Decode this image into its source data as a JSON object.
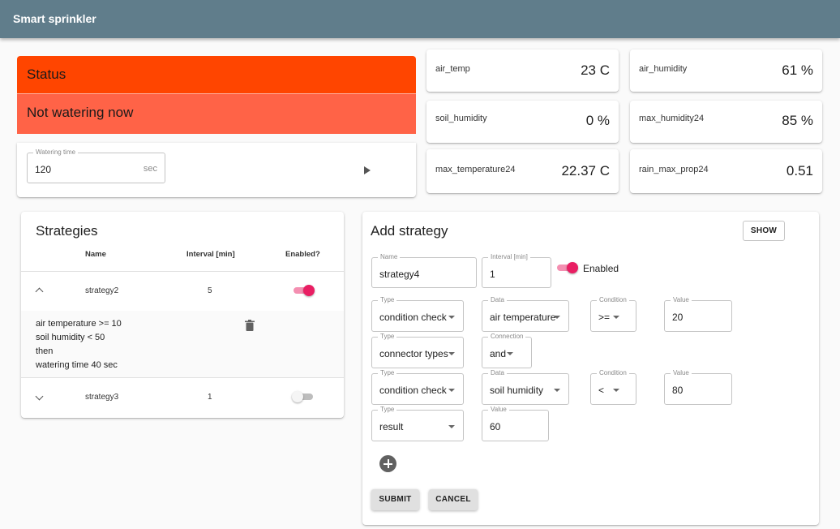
{
  "app": {
    "title": "Smart sprinkler"
  },
  "status": {
    "title": "Status",
    "state": "Not watering now",
    "watering_time": {
      "label": "Watering time",
      "value": "120",
      "unit": "sec"
    },
    "colors": {
      "header": "#ff4500",
      "body": "#ff6347"
    }
  },
  "metrics": [
    {
      "label": "air_temp",
      "value": "23 C"
    },
    {
      "label": "air_humidity",
      "value": "61 %"
    },
    {
      "label": "soil_humidity",
      "value": "0 %"
    },
    {
      "label": "max_humidity24",
      "value": "85 %"
    },
    {
      "label": "max_temperature24",
      "value": "22.37 C"
    },
    {
      "label": "rain_max_prop24",
      "value": "0.51"
    }
  ],
  "strategies": {
    "title": "Strategies",
    "columns": {
      "name": "Name",
      "interval": "Interval [min]",
      "enabled": "Enabled?"
    },
    "rows": [
      {
        "name": "strategy2",
        "interval": "5",
        "enabled": true,
        "expanded": true,
        "details": [
          "air temperature >= 10",
          "soil humidity < 50",
          "then",
          "watering time 40 sec"
        ]
      },
      {
        "name": "strategy3",
        "interval": "1",
        "enabled": false,
        "expanded": false
      }
    ]
  },
  "add_strategy": {
    "title": "Add strategy",
    "show_label": "SHOW",
    "name": {
      "label": "Name",
      "value": "strategy4"
    },
    "interval": {
      "label": "Interval [min]",
      "value": "1"
    },
    "enabled_label": "Enabled",
    "enabled": true,
    "rules": [
      {
        "type_label": "Type",
        "type": "condition check",
        "data_label": "Data",
        "data": "air temperature",
        "condition_label": "Condition",
        "condition": ">=",
        "value_label": "Value",
        "value": "20"
      },
      {
        "type_label": "Type",
        "type": "connector types",
        "connection_label": "Connection",
        "connection": "and"
      },
      {
        "type_label": "Type",
        "type": "condition check",
        "data_label": "Data",
        "data": "soil humidity",
        "condition_label": "Condition",
        "condition": "<",
        "value_label": "Value",
        "value": "80"
      },
      {
        "type_label": "Type",
        "type": "result",
        "value_label": "Value",
        "value": "60"
      }
    ],
    "submit_label": "SUBMIT",
    "cancel_label": "CANCEL"
  },
  "colors": {
    "appbar": "#607d8b",
    "accent": "#e91e63"
  },
  "icons": {
    "play": "play-icon",
    "add": "add-circle-icon",
    "delete": "trash-icon",
    "expand": "chevron-down-icon",
    "collapse": "chevron-up-icon"
  }
}
